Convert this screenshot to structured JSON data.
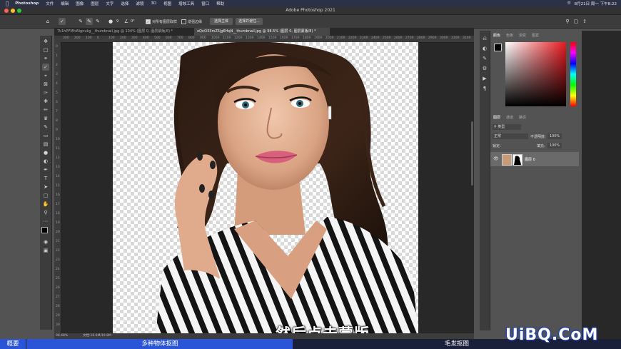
{
  "menubar": {
    "app_name": "Photoshop",
    "items": [
      "文件",
      "编辑",
      "图像",
      "图层",
      "文字",
      "选择",
      "滤镜",
      "3D",
      "视图",
      "增效工具",
      "窗口",
      "帮助"
    ],
    "datetime": "8月21日 周一 下午8:22"
  },
  "window": {
    "title": "Adobe Photoshop 2021"
  },
  "options": {
    "size_value": "9",
    "angle_value": "0°",
    "sample_all_layers": "对所有图层取样",
    "enhance_edge": "增强边缘",
    "select_subject": "选择主体",
    "select_and_mask": "选择并遮住..."
  },
  "tabs": [
    {
      "label": "7k1hPFMhWignukg__thumbnail.jpg @ 104% (图层 0, 图层蒙版/8) *",
      "active": false
    },
    {
      "label": "oQnO33mZ5jg6HqN__thumbnail.jpg @ 98.5% (图层 0, 图层蒙版/8) *",
      "active": true
    }
  ],
  "ruler": {
    "h": [
      "300",
      "200",
      "100",
      "0",
      "100",
      "200",
      "300",
      "400",
      "500",
      "600",
      "700",
      "800",
      "900",
      "1000",
      "1100",
      "1200",
      "1300",
      "1400",
      "1500",
      "1600",
      "1700",
      "1800",
      "1900",
      "2000",
      "2100",
      "2200",
      "2300",
      "2400",
      "2500",
      "2600",
      "2700",
      "2800",
      "2900",
      "3000",
      "3100",
      "3200"
    ],
    "v": [
      "0",
      "1",
      "2",
      "3",
      "4",
      "5",
      "6",
      "7",
      "8",
      "9",
      "10",
      "11",
      "12",
      "13",
      "14",
      "15",
      "16",
      "17",
      "18",
      "19",
      "20",
      "21",
      "22",
      "23",
      "24",
      "25",
      "26",
      "27",
      "28",
      "29",
      "30"
    ]
  },
  "statusbar": {
    "zoom": "98.48%",
    "doc_info": "文档:16.6M/19.8M"
  },
  "color_panel": {
    "tabs": [
      "颜色",
      "色板",
      "渐变",
      "图案"
    ],
    "fg_color": "#000000",
    "bg_color": "#ffffff",
    "hue_color": "#e8191f"
  },
  "layers_panel": {
    "tabs": [
      "图层",
      "通道",
      "路径"
    ],
    "filter": "类型",
    "blend_mode": "正常",
    "opacity_label": "不透明度:",
    "opacity_value": "100%",
    "lock_label": "锁定:",
    "fill_label": "填充:",
    "fill_value": "100%",
    "layers": [
      {
        "name": "图层 0",
        "visible": true
      }
    ]
  },
  "subtitle": "然后点击蒙版",
  "bottom": {
    "left_label": "概要",
    "mid_label": "多种物体抠图",
    "right_label": "毛发抠图"
  },
  "watermark": "UiBQ.CoM",
  "brand_colors": {
    "bottom_blue": "#2b55d8",
    "menubar": "#2c3145",
    "accent": "#e8191f"
  }
}
